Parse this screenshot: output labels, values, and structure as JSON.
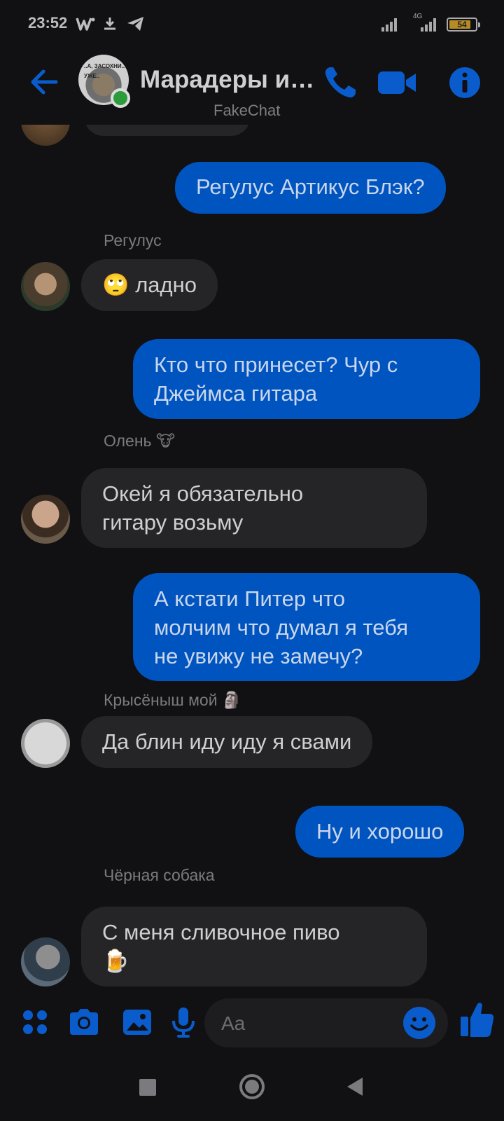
{
  "status_bar": {
    "time": "23:52",
    "network": "4G",
    "battery": "54",
    "icons": [
      "w-app-icon",
      "download-icon",
      "telegram-icon",
      "signal-icon",
      "signal-4g-icon",
      "battery-icon"
    ]
  },
  "header": {
    "title": "Марадеры и …",
    "subtitle": "FakeChat",
    "avatar_caption": "..А, ЗАСОХНИ.. УЖЕ..",
    "icons": [
      "back-arrow-icon",
      "phone-icon",
      "video-call-icon",
      "info-icon"
    ]
  },
  "messages": [
    {
      "type": "outgoing",
      "text": "Регулус Артикус Блэк?"
    },
    {
      "type": "incoming",
      "sender": "Регулус",
      "text": "🙄 ладно"
    },
    {
      "type": "outgoing",
      "lines": [
        "Кто что принесет? Чур с",
        "Джеймса гитара"
      ]
    },
    {
      "type": "incoming",
      "sender": "Олень 🐮",
      "lines": [
        "Окей я обязательно",
        "гитару возьму"
      ]
    },
    {
      "type": "outgoing",
      "lines": [
        "А кстати Питер что",
        "молчим что думал я тебя",
        "не увижу не замечу?"
      ]
    },
    {
      "type": "incoming",
      "sender": "Крысёныш мой 🗿",
      "text": "Да блин иду иду я свами"
    },
    {
      "type": "outgoing",
      "text": "Ну и хорошо"
    },
    {
      "type": "incoming",
      "sender": "Чёрная собака",
      "lines": [
        "С меня сливочное пиво",
        "🍺"
      ]
    }
  ],
  "composer": {
    "placeholder": "Aa",
    "icons": [
      "apps-grid-icon",
      "camera-icon",
      "gallery-icon",
      "microphone-icon",
      "emoji-icon",
      "thumbs-up-icon"
    ]
  },
  "nav_bar": {
    "icons": [
      "recents-square-icon",
      "home-circle-icon",
      "back-triangle-icon"
    ]
  },
  "colors": {
    "background": "#111113",
    "accent": "#0a5ccc",
    "outgoing_bubble": "#0054bf",
    "incoming_bubble": "#252528",
    "online": "#2a9d3a"
  }
}
